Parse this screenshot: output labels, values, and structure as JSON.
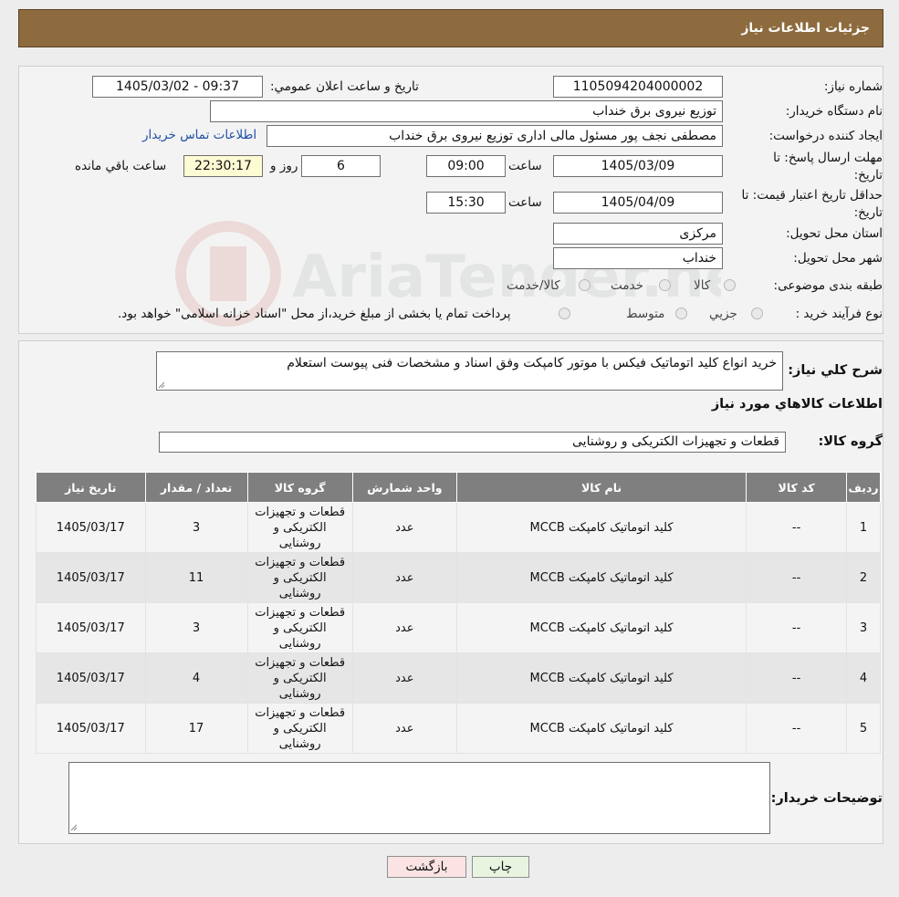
{
  "header": {
    "title": "جزئیات اطلاعات نیاز"
  },
  "form": {
    "need_number_label": "شماره نیاز:",
    "need_number": "1105094204000002",
    "announce_label": "تاریخ و ساعت اعلان عمومي:",
    "announce_value": "1405/03/02 - 09:37",
    "buyer_org_label": "نام دستگاه خريدار:",
    "buyer_org": "توزیع نیروی برق خنداب",
    "creator_label": "ايجاد کننده درخواست:",
    "creator": "مصطفی نجف پور مسئول مالی اداری توزیع نیروی برق خنداب",
    "contact_link": "اطلاعات تماس خريدار",
    "deadline_label": "مهلت ارسال پاسخ: تا تاریخ:",
    "deadline_date": "1405/03/09",
    "time_label": "ساعت",
    "deadline_time": "09:00",
    "days": "6",
    "days_label": "روز و",
    "remaining": "22:30:17",
    "remaining_label": "ساعت باقي مانده",
    "validity_label": "حداقل تاريخ اعتبار قيمت: تا تاریخ:",
    "validity_date": "1405/04/09",
    "validity_time": "15:30",
    "province_label": "استان محل تحويل:",
    "province": "مرکزی",
    "city_label": "شهر محل تحويل:",
    "city": "خنداب",
    "category_label": "طبقه بندی موضوعی:",
    "category_options": [
      "کالا",
      "خدمت",
      "کالا/خدمت"
    ],
    "process_label": "نوع فرآيند خريد :",
    "process_options": [
      "جزیي",
      "متوسط"
    ],
    "process_note": "پرداخت تمام يا بخشی از مبلغ خريد،از محل \"اسناد خزانه اسلامی\" خواهد بود."
  },
  "description": {
    "label": "شرح کلي نياز:",
    "text": "خرید انواع کلید اتوماتیک فیکس با موتور کامپکت وفق اسناد و مشخصات فنی پیوست استعلام",
    "goods_info_title": "اطلاعات کالاهاي مورد نياز",
    "group_label": "گروه کالا:",
    "group_value": "قطعات و تجهیزات الکتریکی و روشنایی"
  },
  "table": {
    "headers": [
      "رديف",
      "کد کالا",
      "نام کالا",
      "واحد شمارش",
      "گروه کالا",
      "تعداد / مقدار",
      "تاريخ نياز"
    ],
    "rows": [
      [
        "1",
        "--",
        "کلید اتوماتیک کامپکت MCCB",
        "عدد",
        "قطعات و تجهیزات الکتریکی و روشنایی",
        "3",
        "1405/03/17"
      ],
      [
        "2",
        "--",
        "کلید اتوماتیک کامپکت MCCB",
        "عدد",
        "قطعات و تجهیزات الکتریکی و روشنایی",
        "11",
        "1405/03/17"
      ],
      [
        "3",
        "--",
        "کلید اتوماتیک کامپکت MCCB",
        "عدد",
        "قطعات و تجهیزات الکتریکی و روشنایی",
        "3",
        "1405/03/17"
      ],
      [
        "4",
        "--",
        "کلید اتوماتیک کامپکت MCCB",
        "عدد",
        "قطعات و تجهیزات الکتریکی و روشنایی",
        "4",
        "1405/03/17"
      ],
      [
        "5",
        "--",
        "کلید اتوماتیک کامپکت MCCB",
        "عدد",
        "قطعات و تجهیزات الکتریکی و روشنایی",
        "17",
        "1405/03/17"
      ]
    ]
  },
  "notes": {
    "label": "توضيحات خريدار:",
    "text": ""
  },
  "buttons": {
    "print": "چاپ",
    "back": "بازگشت"
  },
  "watermark": {
    "text": "AriaTender.neT"
  }
}
